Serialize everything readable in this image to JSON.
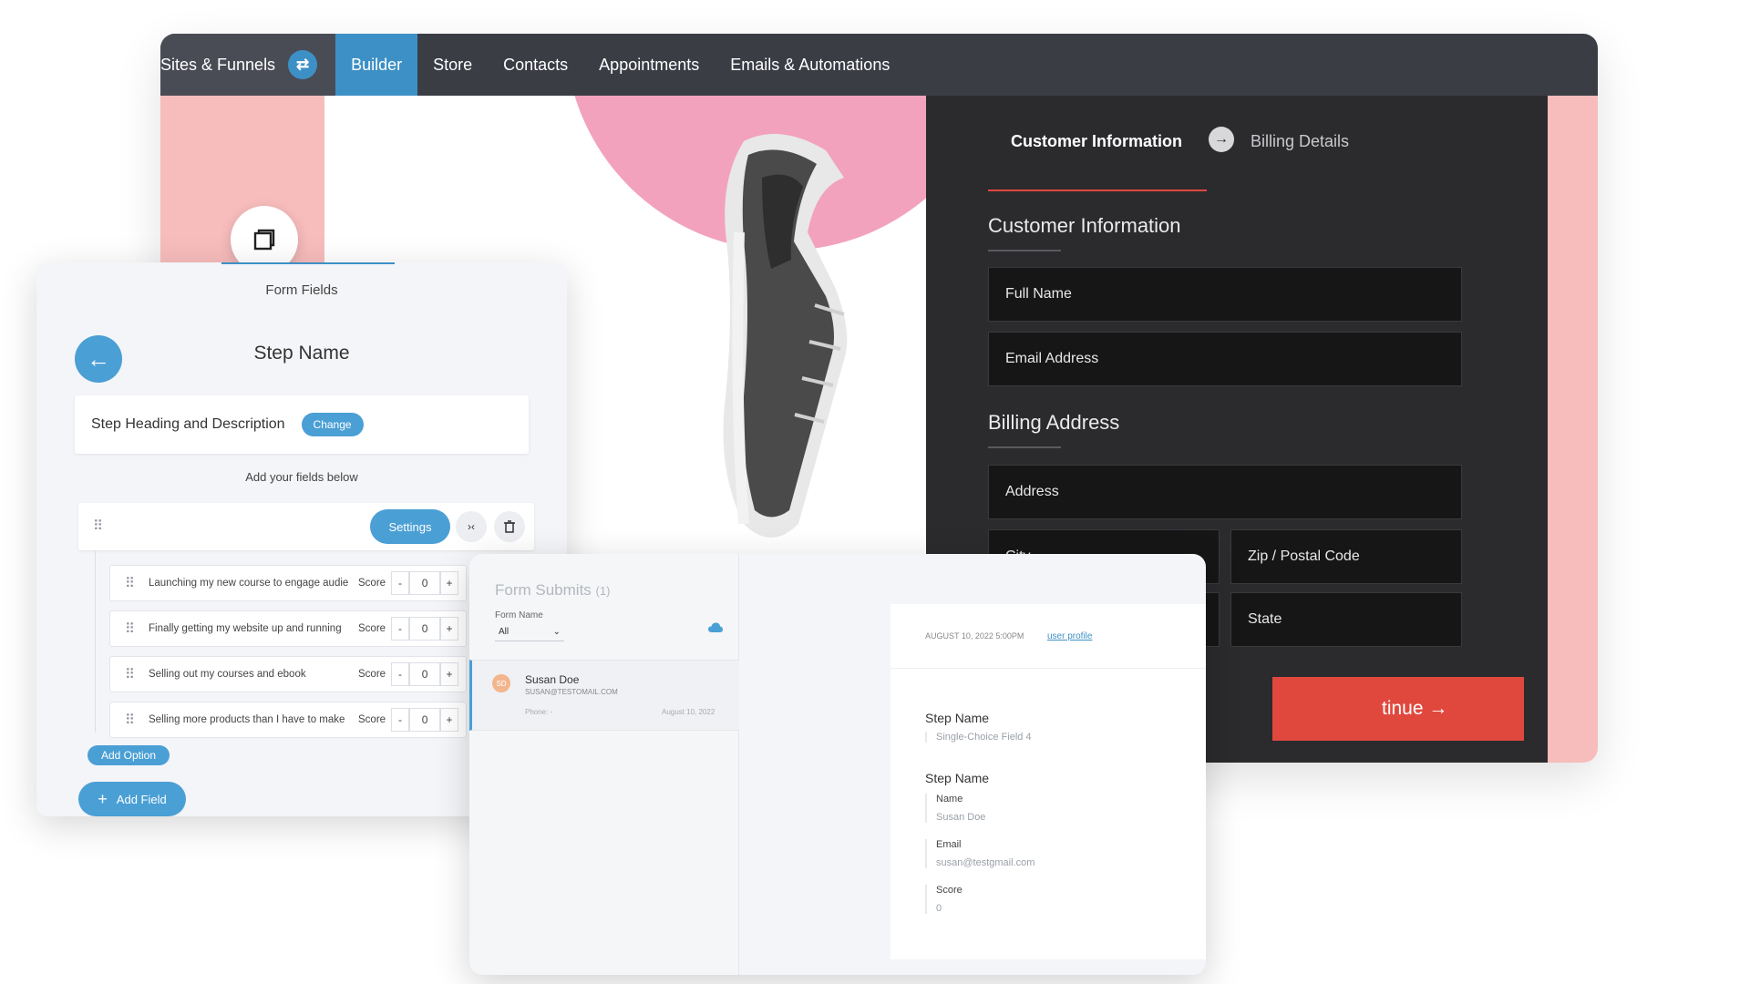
{
  "nav": {
    "sites_funnels": "Sites & Funnels",
    "items": [
      "Builder",
      "Store",
      "Contacts",
      "Appointments",
      "Emails & Automations"
    ]
  },
  "checkout": {
    "tab_active": "Customer Information",
    "tab_next": "Billing Details",
    "customer_heading": "Customer Information",
    "full_name_placeholder": "Full Name",
    "email_placeholder": "Email Address",
    "billing_heading": "Billing Address",
    "address_placeholder": "Address",
    "city_placeholder": "City",
    "zip_placeholder": "Zip / Postal Code",
    "state_placeholder": "State",
    "continue_label": "tinue →"
  },
  "form_fields": {
    "title": "Form Fields",
    "step_name": "Step Name",
    "heading_desc_label": "Step Heading and Description",
    "change_label": "Change",
    "hint": "Add your fields below",
    "settings_label": "Settings",
    "options": [
      {
        "text": "Launching my new course to engage audie",
        "score_label": "Score",
        "value": "0"
      },
      {
        "text": "Finally getting my website up and running",
        "score_label": "Score",
        "value": "0"
      },
      {
        "text": "Selling out my courses and ebook",
        "score_label": "Score",
        "value": "0"
      },
      {
        "text": "Selling more products than I have to make",
        "score_label": "Score",
        "value": "0"
      }
    ],
    "add_option_label": "Add Option",
    "add_field_label": "Add Field"
  },
  "form_submits": {
    "title": "Form Submits",
    "count": "(1)",
    "form_name_label": "Form Name",
    "filter_value": "All",
    "submission": {
      "initials": "SD",
      "name": "Susan Doe",
      "email": "SUSAN@TESTOMAIL.COM",
      "phone": "Phone: -",
      "date": "August 10, 2022"
    },
    "detail": {
      "timestamp": "AUGUST 10, 2022 5:00PM",
      "profile_link": "user profile",
      "step1_title": "Step Name",
      "step1_sub": "Single-Choice Field 4",
      "step2_title": "Step Name",
      "name_label": "Name",
      "name_value": "Susan Doe",
      "email_label": "Email",
      "email_value": "susan@testgmail.com",
      "score_label": "Score",
      "score_value": "0"
    }
  },
  "colors": {
    "nav_bg": "#3b3d45",
    "accent_blue": "#3d90c6",
    "pink": "#f7bcbc",
    "circle_pink": "#f2a2bd",
    "dark_panel": "#2b2b2e",
    "continue_red": "#e0483e"
  }
}
